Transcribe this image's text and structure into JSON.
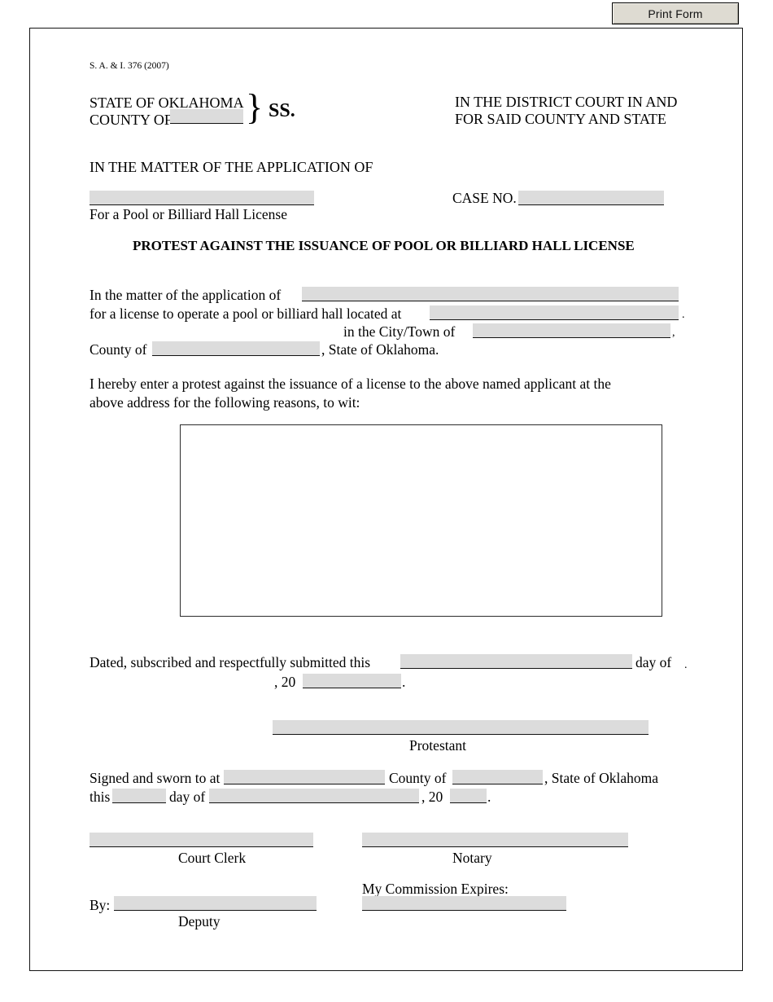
{
  "toolbar": {
    "print_form_label": "Print Form"
  },
  "document": {
    "form_code": "S. A. & I. 376 (2007)",
    "state_line": "STATE OF OKLAHOMA",
    "county_line_label": "COUNTY OF",
    "brace_glyph": "}",
    "ss_label": "SS.",
    "court_line_1": "IN THE DISTRICT COURT IN AND",
    "court_line_2": "FOR SAID COUNTY AND STATE",
    "matter_heading": "IN THE MATTER OF THE APPLICATION OF",
    "applicant_caption": "For a Pool or Billiard Hall License",
    "case_no_label": "CASE NO.",
    "title": "PROTEST AGAINST THE ISSUANCE OF POOL OR BILLIARD HALL LICENSE",
    "body": {
      "line1_prefix": "In the matter of the application of",
      "line2_prefix": "for a license to operate a pool or billiard hall located at",
      "line2_suffix": ".",
      "line3_prefix": "in the City/Town of",
      "line3_suffix": ",",
      "line4_prefix": "County of",
      "line4_suffix": ", State of Oklahoma.",
      "protest_line1": "I hereby enter a protest against the issuance of a license to the above named applicant at the",
      "protest_line2": "above address for the following reasons, to wit:"
    },
    "dated": {
      "prefix": "Dated, subscribed and respectfully submitted this",
      "day_of": "day of",
      "trailing_comma": ".",
      "year_prefix": ", 20",
      "period": "."
    },
    "protestant_label": "Protestant",
    "sworn": {
      "line1_prefix": "Signed and sworn to at",
      "line1_mid": "County of",
      "line1_suffix": ", State of Oklahoma",
      "line2_prefix": "this",
      "line2_day_of": "day of",
      "line2_year_prefix": ", 20",
      "line2_period": "."
    },
    "court_clerk_label": "Court Clerk",
    "notary_label": "Notary",
    "commission_label": "My Commission Expires:",
    "by_label": "By:",
    "deputy_label": "Deputy"
  },
  "fields": {
    "county_top": "",
    "applicant_name_top": "",
    "case_no": "",
    "applicant_name_body": "",
    "address": "",
    "city_town": "",
    "county_body": "",
    "reasons": "",
    "dated_day": "",
    "dated_year": "",
    "protestant_signature": "",
    "sworn_city": "",
    "sworn_county": "",
    "sworn_day": "",
    "sworn_month": "",
    "sworn_year": "",
    "court_clerk_signature": "",
    "notary_signature": "",
    "deputy_signature": "",
    "commission_expires": ""
  },
  "colors": {
    "field_fill": "#dcdcdc",
    "field_underline": "#131313",
    "page_border": "#141414",
    "button_face": "#dedbd2"
  }
}
